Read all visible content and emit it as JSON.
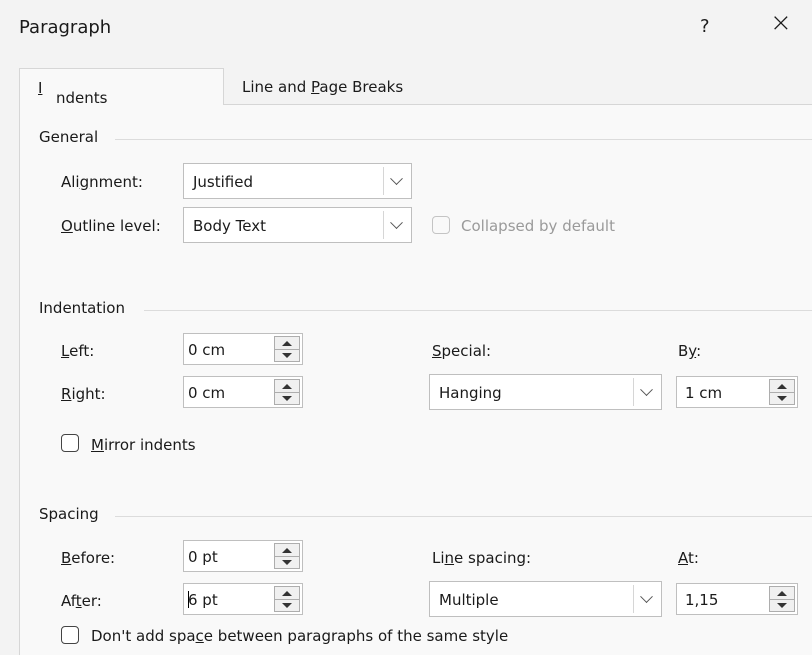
{
  "dialog": {
    "title": "Paragraph",
    "help": "?",
    "close": "×"
  },
  "tabs": [
    {
      "pre": "",
      "key": "I",
      "post": "ndents and Spacing",
      "active": true
    },
    {
      "pre": "Line and ",
      "key": "P",
      "post": "age Breaks",
      "active": false
    }
  ],
  "general": {
    "label": "General",
    "alignment": {
      "pre": "Ali",
      "key": "g",
      "post": "nment:",
      "value": "Justified"
    },
    "outline": {
      "pre": "",
      "key": "O",
      "post": "utline level:",
      "value": "Body Text"
    },
    "collapsed": {
      "label": "Collapsed by default",
      "checked": false,
      "disabled": true
    }
  },
  "indentation": {
    "label": "Indentation",
    "left": {
      "pre": "",
      "key": "L",
      "post": "eft:",
      "value": "0 cm"
    },
    "right": {
      "pre": "",
      "key": "R",
      "post": "ight:",
      "value": "0 cm"
    },
    "special": {
      "pre": "",
      "key": "S",
      "post": "pecial:",
      "value": "Hanging"
    },
    "by": {
      "pre": "B",
      "key": "y",
      "post": ":",
      "value": "1 cm"
    },
    "mirror": {
      "pre": "",
      "key": "M",
      "post": "irror indents",
      "checked": false
    }
  },
  "spacing": {
    "label": "Spacing",
    "before": {
      "pre": "",
      "key": "B",
      "post": "efore:",
      "value": "0 pt"
    },
    "after": {
      "pre": "Af",
      "key": "t",
      "post": "er:",
      "value": "6 pt"
    },
    "line_spacing": {
      "pre": "Li",
      "key": "n",
      "post": "e spacing:",
      "value": "Multiple"
    },
    "at": {
      "pre": "",
      "key": "A",
      "post": "t:",
      "value": "1,15"
    },
    "dont_add": {
      "pre": "Don't add spa",
      "key": "c",
      "post": "e between paragraphs of the same style",
      "checked": false
    }
  }
}
